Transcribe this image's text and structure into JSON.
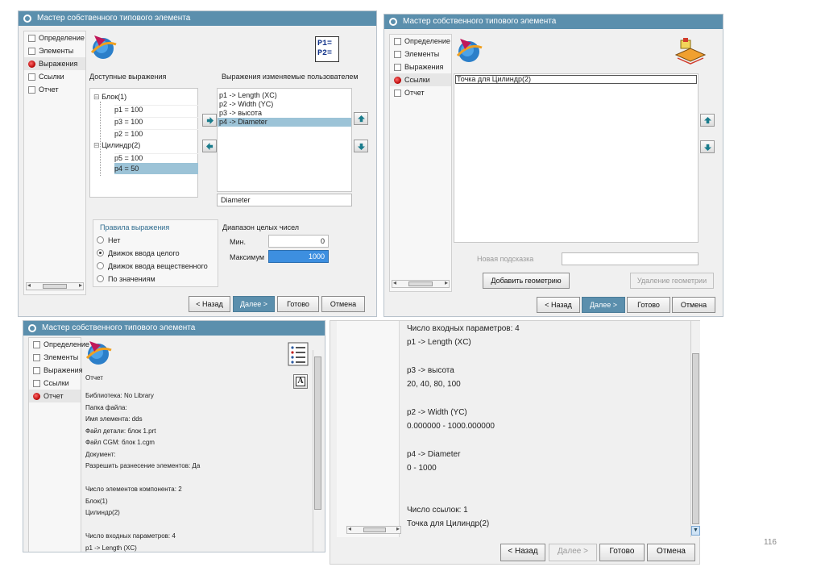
{
  "window_title": "Мастер собственного типового элемента",
  "nav_items": [
    "Определение",
    "Элементы",
    "Выражения",
    "Ссылки",
    "Отчет"
  ],
  "buttons": {
    "back": "< Назад",
    "next": "Далее >",
    "done": "Готово",
    "cancel": "Отмена"
  },
  "expr": {
    "available_label": "Доступные выражения",
    "user_label": "Выражения изменяемые пользователем",
    "tree": {
      "node1": "Блок(1)",
      "n1_p1": "p1 = 100",
      "n1_p3": "p3 = 100",
      "n1_p2": "p2 = 100",
      "node2": "Цилиндр(2)",
      "n2_p5": "p5 = 100",
      "n2_p4": "p4 = 50"
    },
    "user_list": [
      "p1 -> Length (XC)",
      "p2 -> Width (YC)",
      "p3 -> высота",
      "p4 -> Diameter"
    ],
    "selected_name": "Diameter",
    "rules_title": "Правила выражения",
    "rules": [
      "Нет",
      "Движок ввода целого",
      "Движок ввода вещественного",
      "По значениям"
    ],
    "range_title": "Диапазон целых чисел",
    "min_label": "Мин.",
    "min_value": "0",
    "max_label": "Максимум",
    "max_value": "1000",
    "logo_text_1": "P1=",
    "logo_text_2": "P2="
  },
  "refs": {
    "list_item": "Точка для Цилиндр(2)",
    "hint_label": "Новая подсказка",
    "add_geometry": "Добавить геометрию",
    "remove_geometry": "Удаление геометрии"
  },
  "report": {
    "label": "Отчет",
    "lines": [
      "Библиотека: No Library",
      "Папка файла:",
      "Имя элемента: dds",
      "Файл детали: блок 1.prt",
      "Файл CGM: блок 1.cgm",
      "Документ:",
      "Разрешить разнесение элементов: Да",
      "",
      "Число элементов компонента: 2",
      "Блок(1)",
      "Цилиндр(2)",
      "",
      "Число входных параметров: 4",
      "p1 -> Length (XC)"
    ]
  },
  "report2": {
    "lines": [
      "Число входных параметров: 4",
      "p1 -> Length (XC)",
      "",
      "p3 -> высота",
      "20, 40, 80, 100",
      "",
      "p2 -> Width (YC)",
      "0.000000 - 1000.000000",
      "",
      "p4 -> Diameter",
      "0 - 1000",
      "",
      "",
      "Число ссылок: 1",
      "Точка для Цилиндр(2)"
    ]
  },
  "page_number": "116",
  "colors": {
    "title_bar": "#5b8fad",
    "selection": "#9cc3d7",
    "primary_button": "#5b8fad"
  }
}
